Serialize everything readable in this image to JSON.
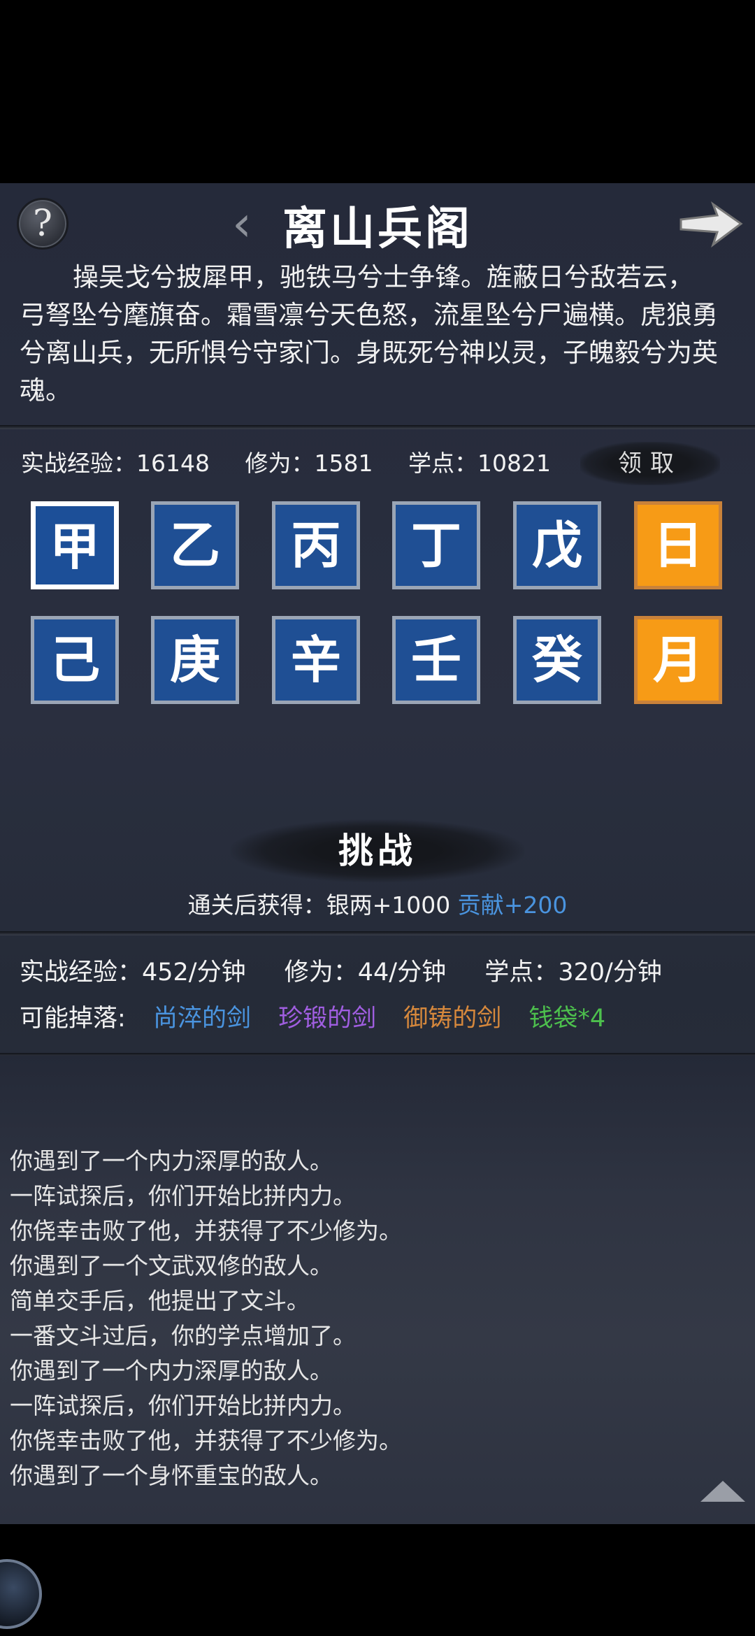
{
  "header": {
    "help_icon": "question-mark",
    "help_glyph": "?",
    "prev_glyph": "‹",
    "title": "离山兵阁",
    "next_icon": "right-arrow"
  },
  "description": "操吴戈兮披犀甲，驰铁马兮士争锋。旌蔽日兮敌若云，弓弩坠兮麾旗奋。霜雪凛兮天色怒，流星坠兮尸遍横。虎狼勇兮离山兵，无所惧兮守家门。身既死兮神以灵，子魄毅兮为英魂。",
  "stats": {
    "combat_exp": "实战经验：16148",
    "cultivation": "修为：1581",
    "study_points": "学点：10821",
    "claim_label": "领取"
  },
  "stages": {
    "row1": [
      "甲",
      "乙",
      "丙",
      "丁",
      "戊",
      "日"
    ],
    "row2": [
      "己",
      "庚",
      "辛",
      "壬",
      "癸",
      "月"
    ],
    "selected": "甲"
  },
  "challenge": {
    "label": "挑战",
    "reward_prefix": "通关后获得：银两+1000 ",
    "reward_contribution": "贡献+200"
  },
  "rates": {
    "combat_exp": "实战经验：452/分钟",
    "cultivation": "修为：44/分钟",
    "study_points": "学点：320/分钟"
  },
  "drops": {
    "label": "可能掉落:",
    "items": [
      {
        "name": "尚淬的剑",
        "color": "#4a94df"
      },
      {
        "name": "珍锻的剑",
        "color": "#a05ee0"
      },
      {
        "name": "御铸的剑",
        "color": "#d6883c"
      },
      {
        "name": "钱袋*4",
        "color": "#4dc04d"
      }
    ]
  },
  "log": [
    "你遇到了一个内力深厚的敌人。",
    "一阵试探后，你们开始比拼内力。",
    "你侥幸击败了他，并获得了不少修为。",
    "你遇到了一个文武双修的敌人。",
    "简单交手后，他提出了文斗。",
    "一番文斗过后，你的学点增加了。",
    "你遇到了一个内力深厚的敌人。",
    "一阵试探后，你们开始比拼内力。",
    "你侥幸击败了他，并获得了不少修为。",
    "你遇到了一个身怀重宝的敌人。"
  ],
  "colors": {
    "tile_blue": "#1f4f94",
    "tile_gold": "#f79b16",
    "accent_blue": "#4a94df"
  }
}
